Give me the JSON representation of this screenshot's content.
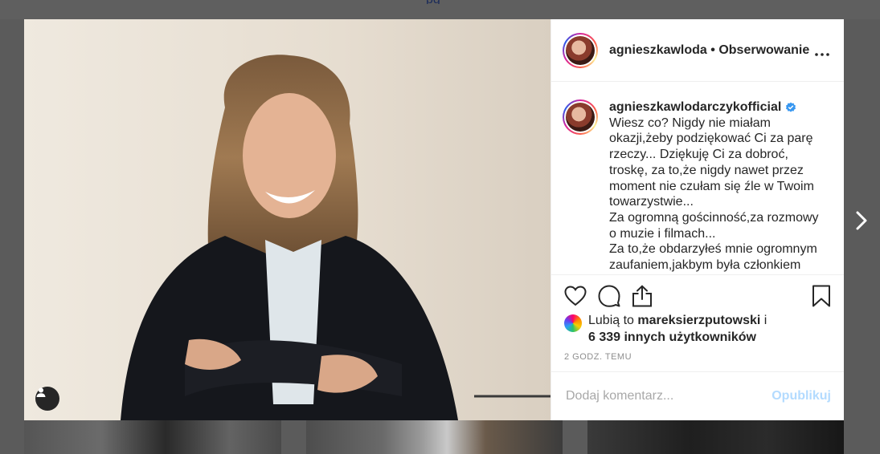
{
  "background": {
    "top_text": "pg"
  },
  "post": {
    "header": {
      "username": "agnieszkawloda",
      "separator": " • ",
      "follow_status": "Obserwowanie"
    },
    "caption": {
      "username": "agnieszkawlodarczykofficial",
      "lines": [
        "Wiesz co? Nigdy nie miałam",
        "okazji,żeby podziękować Ci za parę",
        "rzeczy... Dziękuję Ci za dobroć,",
        "troskę, za to,że nigdy nawet przez",
        "moment nie czułam się źle w Twoim",
        "towarzystwie...",
        "Za ogromną gościnność,za rozmowy",
        "o muzie i filmach...",
        "Za to,że obdarzyłeś mnie ogromnym",
        "zaufaniem,jakbym była członkiem"
      ]
    },
    "likes": {
      "prefix": "Lubią to ",
      "user": "mareksierzputowski",
      "suffix": " i",
      "others": "6 339 innych użytkowników"
    },
    "timestamp": "2 GODZ. TEMU",
    "comment": {
      "placeholder": "Dodaj komentarz...",
      "publish_label": "Opublikuj"
    }
  },
  "colors": {
    "verified": "#3897f0",
    "publish_disabled": "#b3dbff",
    "overlay": "#5b5b5b"
  },
  "icons": [
    "more-icon",
    "verified-badge-icon",
    "heart-icon",
    "comment-icon",
    "share-icon",
    "bookmark-icon",
    "user-tag-icon",
    "chevron-right-icon"
  ]
}
